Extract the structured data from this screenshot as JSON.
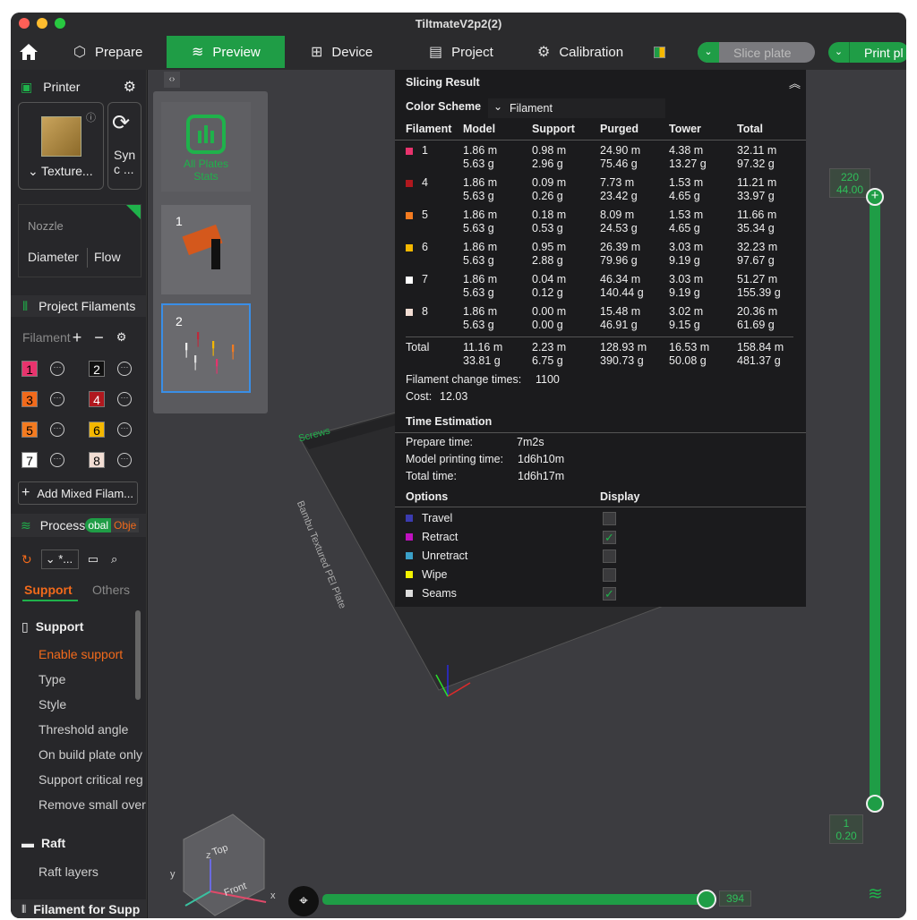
{
  "window": {
    "title": "TiltmateV2p2(2)"
  },
  "tabs": {
    "prepare": "Prepare",
    "preview": "Preview",
    "device": "Device",
    "project": "Project",
    "calibration": "Calibration",
    "slice_plate": "Slice plate",
    "print_plate": "Print pl"
  },
  "sidebar": {
    "printer_label": "Printer",
    "plate_type": "Texture...",
    "sync_label_1": "Syn",
    "sync_label_2": "c ...",
    "nozzle_label": "Nozzle",
    "diameter_label": "Diameter",
    "flow_label": "Flow",
    "project_filaments_label": "Project Filaments",
    "filament_header": "Filament",
    "filaments": [
      {
        "num": "1",
        "color": "#e8336d",
        "text_color": "#000000"
      },
      {
        "num": "2",
        "color": "#111111",
        "text_color": "#ffffff"
      },
      {
        "num": "3",
        "color": "#f26a1b",
        "text_color": "#000000"
      },
      {
        "num": "4",
        "color": "#b0181e",
        "text_color": "#ffffff"
      },
      {
        "num": "5",
        "color": "#f47b20",
        "text_color": "#000000"
      },
      {
        "num": "6",
        "color": "#f5b800",
        "text_color": "#000000"
      },
      {
        "num": "7",
        "color": "#ffffff",
        "text_color": "#000000"
      },
      {
        "num": "8",
        "color": "#f2ddd3",
        "text_color": "#000000"
      }
    ],
    "add_mixed": "Add Mixed Filam...",
    "process_label": "Process",
    "global_label": "obal",
    "objects_label": "Obje",
    "preset_value": "*...",
    "support_tab": "Support",
    "others_tab": "Others",
    "support_group": "Support",
    "support_items": [
      "Enable support",
      "Type",
      "Style",
      "Threshold angle",
      "On build plate only",
      "Support critical reg",
      "Remove small over"
    ],
    "raft_group": "Raft",
    "raft_items": [
      "Raft layers"
    ],
    "filament_for_supp": "Filament for Supp"
  },
  "plates": {
    "all_plates_1": "All Plates",
    "all_plates_2": "Stats",
    "plate1": "1",
    "plate2": "2"
  },
  "slicing": {
    "title": "Slicing Result",
    "color_scheme_label": "Color Scheme",
    "color_scheme_value": "Filament",
    "headers": [
      "Filament",
      "Model",
      "Support",
      "Purged",
      "Tower",
      "Total"
    ],
    "rows": [
      {
        "id": "1",
        "color": "#e8336d",
        "model": [
          "1.86 m",
          "5.63 g"
        ],
        "support": [
          "0.98 m",
          "2.96 g"
        ],
        "purged": [
          "24.90 m",
          "75.46 g"
        ],
        "tower": [
          "4.38 m",
          "13.27 g"
        ],
        "total": [
          "32.11 m",
          "97.32 g"
        ]
      },
      {
        "id": "4",
        "color": "#b0181e",
        "model": [
          "1.86 m",
          "5.63 g"
        ],
        "support": [
          "0.09 m",
          "0.26 g"
        ],
        "purged": [
          "7.73 m",
          "23.42 g"
        ],
        "tower": [
          "1.53 m",
          "4.65 g"
        ],
        "total": [
          "11.21 m",
          "33.97 g"
        ]
      },
      {
        "id": "5",
        "color": "#f47b20",
        "model": [
          "1.86 m",
          "5.63 g"
        ],
        "support": [
          "0.18 m",
          "0.53 g"
        ],
        "purged": [
          "8.09 m",
          "24.53 g"
        ],
        "tower": [
          "1.53 m",
          "4.65 g"
        ],
        "total": [
          "11.66 m",
          "35.34 g"
        ]
      },
      {
        "id": "6",
        "color": "#f5b800",
        "model": [
          "1.86 m",
          "5.63 g"
        ],
        "support": [
          "0.95 m",
          "2.88 g"
        ],
        "purged": [
          "26.39 m",
          "79.96 g"
        ],
        "tower": [
          "3.03 m",
          "9.19 g"
        ],
        "total": [
          "32.23 m",
          "97.67 g"
        ]
      },
      {
        "id": "7",
        "color": "#ffffff",
        "model": [
          "1.86 m",
          "5.63 g"
        ],
        "support": [
          "0.04 m",
          "0.12 g"
        ],
        "purged": [
          "46.34 m",
          "140.44 g"
        ],
        "tower": [
          "3.03 m",
          "9.19 g"
        ],
        "total": [
          "51.27 m",
          "155.39 g"
        ]
      },
      {
        "id": "8",
        "color": "#f2ddd3",
        "model": [
          "1.86 m",
          "5.63 g"
        ],
        "support": [
          "0.00 m",
          "0.00 g"
        ],
        "purged": [
          "15.48 m",
          "46.91 g"
        ],
        "tower": [
          "3.02 m",
          "9.15 g"
        ],
        "total": [
          "20.36 m",
          "61.69 g"
        ]
      }
    ],
    "total_row": {
      "label": "Total",
      "model": [
        "11.16 m",
        "33.81 g"
      ],
      "support": [
        "2.23 m",
        "6.75 g"
      ],
      "purged": [
        "128.93 m",
        "390.73 g"
      ],
      "tower": [
        "16.53 m",
        "50.08 g"
      ],
      "total": [
        "158.84 m",
        "481.37 g"
      ]
    },
    "filament_change_label": "Filament change times:",
    "filament_change_value": "1100",
    "cost_label": "Cost:",
    "cost_value": "12.03",
    "time_title": "Time Estimation",
    "prepare_time_label": "Prepare time:",
    "prepare_time_value": "7m2s",
    "model_time_label": "Model printing time:",
    "model_time_value": "1d6h10m",
    "total_time_label": "Total time:",
    "total_time_value": "1d6h17m",
    "options_label": "Options",
    "display_label": "Display",
    "options": [
      {
        "name": "Travel",
        "color": "#3b3bb0",
        "checked": false
      },
      {
        "name": "Retract",
        "color": "#c011c0",
        "checked": true
      },
      {
        "name": "Unretract",
        "color": "#3aa0c8",
        "checked": false
      },
      {
        "name": "Wipe",
        "color": "#f2f200",
        "checked": false
      },
      {
        "name": "Seams",
        "color": "#dddddd",
        "checked": true
      }
    ]
  },
  "sliders": {
    "top_layer": "220",
    "top_height": "44.00",
    "bottom_layer": "1",
    "bottom_height": "0.20",
    "horizontal_value": "394"
  },
  "viewport": {
    "plate_label_1": "Screws",
    "plate_label_2": "Bambu Textured PEI Plate",
    "cube_top": "Top",
    "cube_front": "Front",
    "axis_x": "x",
    "axis_y": "y",
    "axis_z": "z"
  }
}
